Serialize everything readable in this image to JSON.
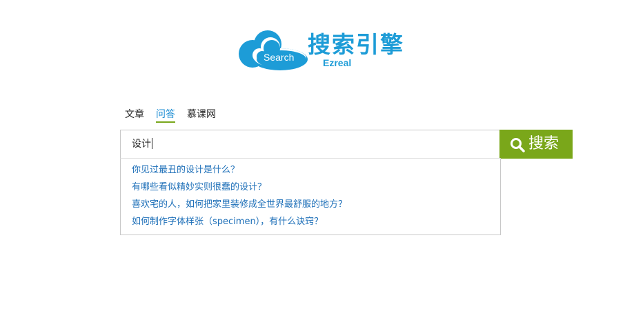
{
  "logo": {
    "cloud_text": "Search",
    "title": "搜索引擎",
    "subtitle": "Ezreal"
  },
  "tabs": [
    {
      "label": "文章",
      "active": false
    },
    {
      "label": "问答",
      "active": true
    },
    {
      "label": "慕课网",
      "active": false
    }
  ],
  "search": {
    "value": "设计",
    "button_label": "搜索",
    "button_icon": "search-icon"
  },
  "suggestions": [
    "你见过最丑的设计是什么？",
    "有哪些看似精妙实则很蠢的设计？",
    "喜欢宅的人，如何把家里装修成全世界最舒服的地方？",
    "如何制作字体样张（specimen），有什么诀窍？"
  ],
  "colors": {
    "brand_blue": "#1d9cd7",
    "accent_green": "#7aa71a",
    "link_blue": "#1d6fb8"
  }
}
